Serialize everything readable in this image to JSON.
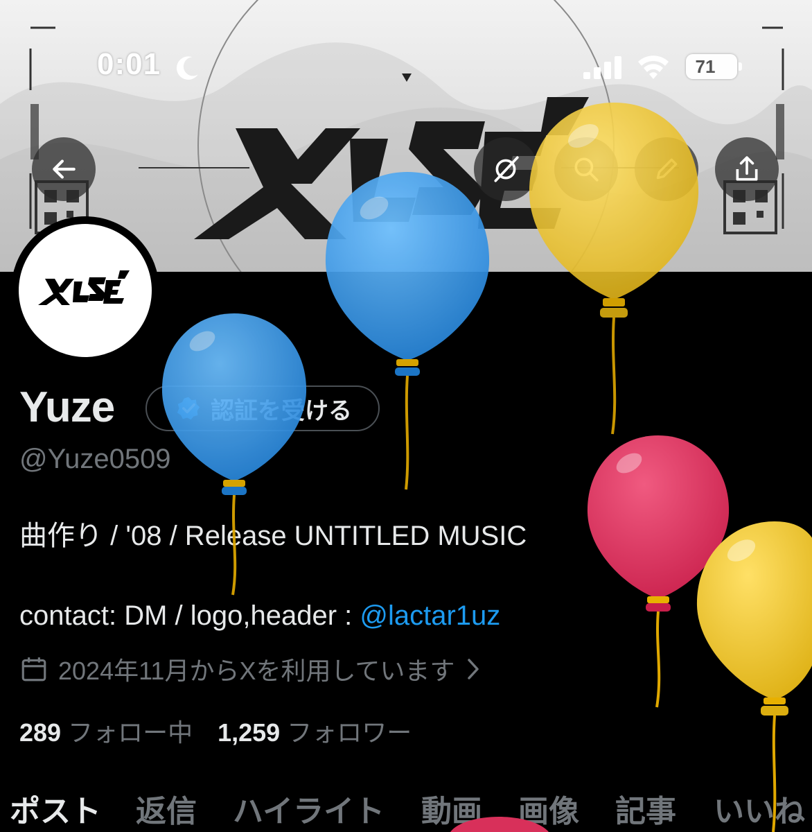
{
  "status_bar": {
    "time": "0:01",
    "battery": "71",
    "icons": [
      "moon-icon",
      "signal-icon",
      "wifi-icon",
      "battery-icon"
    ]
  },
  "header": {
    "banner_logo_text": "YUZE",
    "buttons": [
      "back-arrow-icon",
      "grok-icon",
      "search-icon",
      "compose-icon",
      "share-icon"
    ]
  },
  "profile": {
    "display_name": "Yuze",
    "verify_label": "認証を受ける",
    "handle": "@Yuze0509",
    "bio_line1": "曲作り / '08 / Release UNTITLED MUSIC",
    "bio_line2_prefix": "contact: DM / logo,header : ",
    "bio_link": "@lactar1uz",
    "joined": "2024年11月からXを利用しています",
    "following_count": "289",
    "following_label": "フォロー中",
    "followers_count": "1,259",
    "followers_label": "フォロワー"
  },
  "tabs": [
    {
      "label": "ポスト",
      "active": true
    },
    {
      "label": "返信",
      "active": false
    },
    {
      "label": "ハイライト",
      "active": false
    },
    {
      "label": "動画",
      "active": false
    },
    {
      "label": "画像",
      "active": false
    },
    {
      "label": "記事",
      "active": false
    },
    {
      "label": "いいね",
      "active": false
    }
  ],
  "colors": {
    "background": "#000000",
    "text_primary": "#e7e9ea",
    "text_secondary": "#71767b",
    "link": "#1d9bf0",
    "balloon_blue": "#2f8fe0",
    "balloon_yellow": "#e8be1a",
    "balloon_red": "#d8305a"
  }
}
